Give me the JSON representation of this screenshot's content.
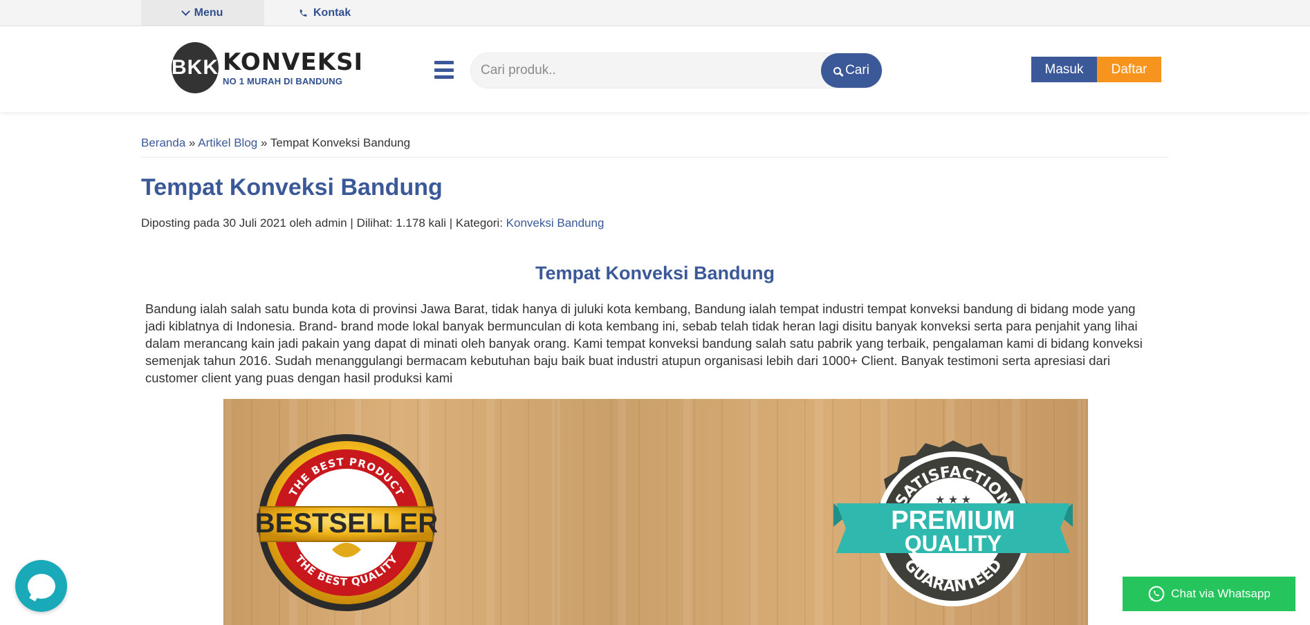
{
  "topbar": {
    "menu_label": "Menu",
    "kontak_label": "Kontak"
  },
  "logo": {
    "mark": "BKK",
    "name": "KONVEKSI",
    "tagline": "NO 1 MURAH DI BANDUNG"
  },
  "search": {
    "placeholder": "Cari produk..",
    "button_label": "Cari"
  },
  "auth": {
    "login_label": "Masuk",
    "register_label": "Daftar"
  },
  "breadcrumb": {
    "home": "Beranda",
    "sep1": " » ",
    "blog": "Artikel Blog",
    "sep2": " » ",
    "current": "Tempat Konveksi Bandung"
  },
  "article": {
    "title": "Tempat Konveksi Bandung",
    "meta_prefix": "Diposting pada 30 Juli 2021 oleh admin | Dilihat: 1.178 kali | Kategori: ",
    "category": "Konveksi Bandung",
    "subtitle": "Tempat Konveksi Bandung",
    "paragraph": "Bandung ialah salah satu bunda kota di provinsi Jawa Barat, tidak hanya di juluki kota kembang, Bandung ialah tempat industri tempat konveksi bandung di bidang mode yang jadi kiblatnya di Indonesia. Brand- brand mode lokal banyak bermunculan di kota kembang ini, sebab telah tidak heran lagi disitu banyak konveksi serta para penjahit yang lihai dalam merancang kain jadi pakain yang dapat di minati oleh banyak orang. Kami tempat konveksi bandung salah satu pabrik yang terbaik, pengalaman kami di bidang konveksi semenjak tahun 2016. Sudah menanggulangi bermacam kebutuhan baju baik buat industri atupun organisasi lebih dari 1000+ Client. Banyak testimoni serta apresiasi dari customer client yang puas dengan hasil produksi kami"
  },
  "banner": {
    "badge_left": {
      "top_text": "THE BEST PRODUCT",
      "main_text": "BESTSELLER",
      "bottom_text": "THE BEST QUALITY"
    },
    "badge_right": {
      "top_text": "SATISFACTION",
      "stars": "★ ★ ★",
      "line1": "PREMIUM",
      "line2": "QUALITY",
      "bottom_text": "GUARANTEED"
    }
  },
  "whatsapp": {
    "label": "Chat via Whatsapp"
  },
  "colors": {
    "primary": "#3b5998",
    "accent": "#f7941d",
    "whatsapp": "#25c45c",
    "chat": "#1aa9b8"
  }
}
